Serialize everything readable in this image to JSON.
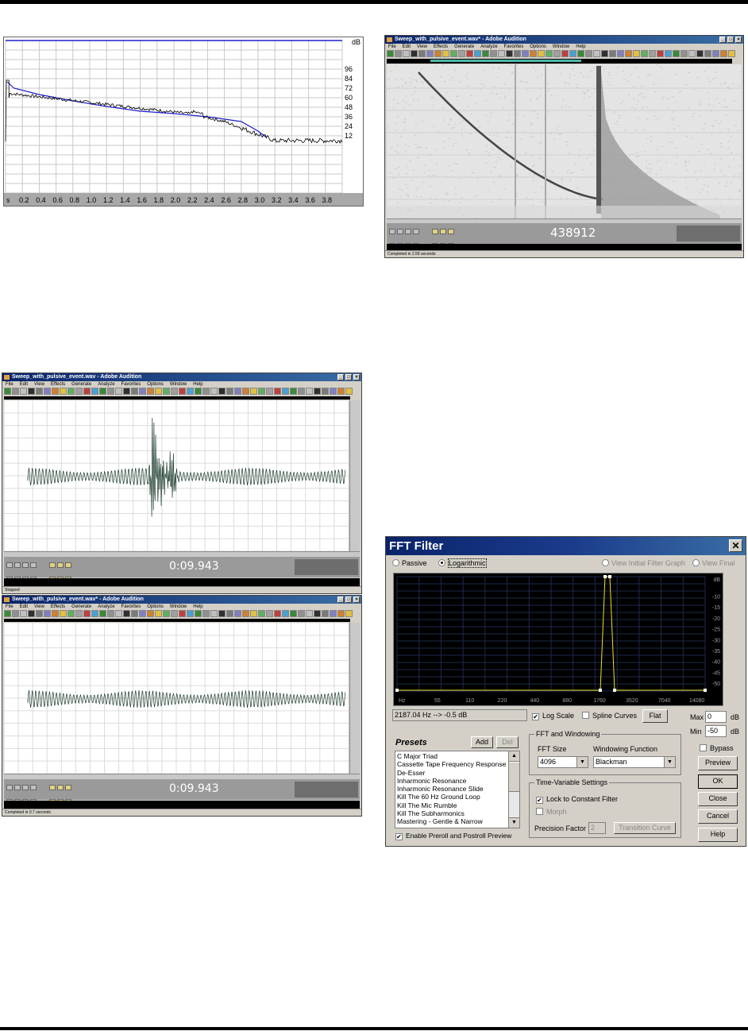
{
  "decay_plot": {
    "unit_label": "dB",
    "y_ticks": [
      "96",
      "84",
      "72",
      "60",
      "48",
      "36",
      "24",
      "12"
    ],
    "x_ticks": [
      "s",
      "0.2",
      "0.4",
      "0.6",
      "0.8",
      "1.0",
      "1.2",
      "1.4",
      "1.6",
      "1.8",
      "2.0",
      "2.2",
      "2.4",
      "2.6",
      "2.8",
      "3.0",
      "3.2",
      "3.4",
      "3.6",
      "3.8"
    ],
    "colors": {
      "curve": "#000000",
      "envelope": "#1f1fcc"
    }
  },
  "spectral_window": {
    "title": "Sweep_with_pulsive_event.wav* - Adobe Audition",
    "menu": [
      "File",
      "Edit",
      "View",
      "Effects",
      "Generate",
      "Analyze",
      "Favorites",
      "Options",
      "Window",
      "Help"
    ],
    "time_display": "438912",
    "status": "Completed in 2.59 seconds"
  },
  "wave_window_1": {
    "title": "Sweep_with_pulsive_event.wav - Adobe Audition",
    "menu": [
      "File",
      "Edit",
      "View",
      "Effects",
      "Generate",
      "Analyze",
      "Favorites",
      "Options",
      "Window",
      "Help"
    ],
    "time_display": "0:09.943",
    "status": "Stopped"
  },
  "wave_window_2": {
    "title": "Sweep_with_pulsive_event.wav* - Adobe Audition",
    "menu": [
      "File",
      "Edit",
      "View",
      "Effects",
      "Generate",
      "Analyze",
      "Favorites",
      "Options",
      "Window",
      "Help"
    ],
    "time_display": "0:09.943",
    "status": "Completed in 0.7 seconds"
  },
  "fft_filter": {
    "title": "FFT Filter",
    "mode_passive": "Passive",
    "mode_logarithmic": "Logarithmic",
    "view_time_variable": "View Initial Filter Graph",
    "view_final": "View Final",
    "graph_db_ticks": [
      "dB",
      "-10",
      "-15",
      "-20",
      "-25",
      "-30",
      "-35",
      "-40",
      "-45",
      "-50"
    ],
    "graph_freq_ticks": [
      "Hz",
      "55",
      "110",
      "220",
      "440",
      "880",
      "1760",
      "3520",
      "7040",
      "14080"
    ],
    "readout": "2187.04 Hz --> -0.5 dB",
    "log_scale": "Log Scale",
    "spline_curves": "Spline Curves",
    "flat_button": "Flat",
    "max_label": "Max",
    "max_value": "0",
    "min_label": "Min",
    "min_value": "-50",
    "db_unit": "dB",
    "presets_title": "Presets",
    "add_button": "Add",
    "del_button": "Del",
    "presets": [
      "C Major Triad",
      "Cassette Tape Frequency Response",
      "De-Esser",
      "Inharmonic Resonance",
      "Inharmonic Resonance Slide",
      "Kill The 60 Hz Ground Loop",
      "Kill The Mic Rumble",
      "Kill The Subharmonics",
      "Mastering - Gentle & Narrow"
    ],
    "enable_preroll": "Enable Preroll and Postroll Preview",
    "fft_group": "FFT and Windowing",
    "fft_size_label": "FFT Size",
    "fft_size_value": "4096",
    "windowing_label": "Windowing Function",
    "windowing_value": "Blackman",
    "time_variable_group": "Time-Variable Settings",
    "lock_label": "Lock to Constant Filter",
    "morph_label": "Morph",
    "precision_label": "Precision Factor",
    "precision_value": "2",
    "transition_button": "Transition Curve",
    "bypass_label": "Bypass",
    "preview_button": "Preview",
    "ok_button": "OK",
    "close_button": "Close",
    "cancel_button": "Cancel",
    "help_button": "Help"
  }
}
